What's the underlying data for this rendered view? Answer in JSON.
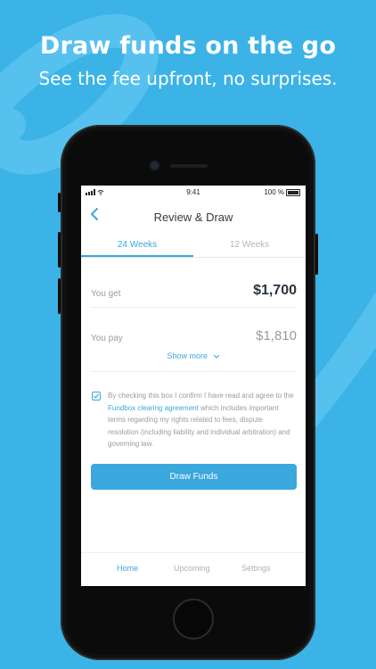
{
  "promo": {
    "headline": "Draw funds on the go",
    "subheadline": "See the fee upfront, no surprises."
  },
  "status_bar": {
    "time": "9:41",
    "battery": "100 %"
  },
  "header": {
    "title": "Review & Draw"
  },
  "tabs": [
    {
      "label": "24 Weeks",
      "active": true
    },
    {
      "label": "12 Weeks",
      "active": false
    }
  ],
  "summary": {
    "get_label": "You get",
    "get_value": "$1,700",
    "pay_label": "You pay",
    "pay_value": "$1,810",
    "show_more": "Show more"
  },
  "agreement": {
    "checked": true,
    "text_before": "By checking this box I confirm I have read and agree to the ",
    "link_text": "Fundbox clearing agreement",
    "text_after": " which includes important terms regarding my rights related to fees, dispute resolution (including liability and individual arbitration) and governing law."
  },
  "actions": {
    "draw_label": "Draw Funds"
  },
  "bottom_nav": [
    {
      "label": "Home",
      "active": true
    },
    {
      "label": "Upcoming",
      "active": false
    },
    {
      "label": "Settings",
      "active": false
    }
  ],
  "colors": {
    "background": "#3bb3e6",
    "accent": "#3aa7dd",
    "primary_text": "#2a3340",
    "muted_text": "#9b9b9b"
  }
}
